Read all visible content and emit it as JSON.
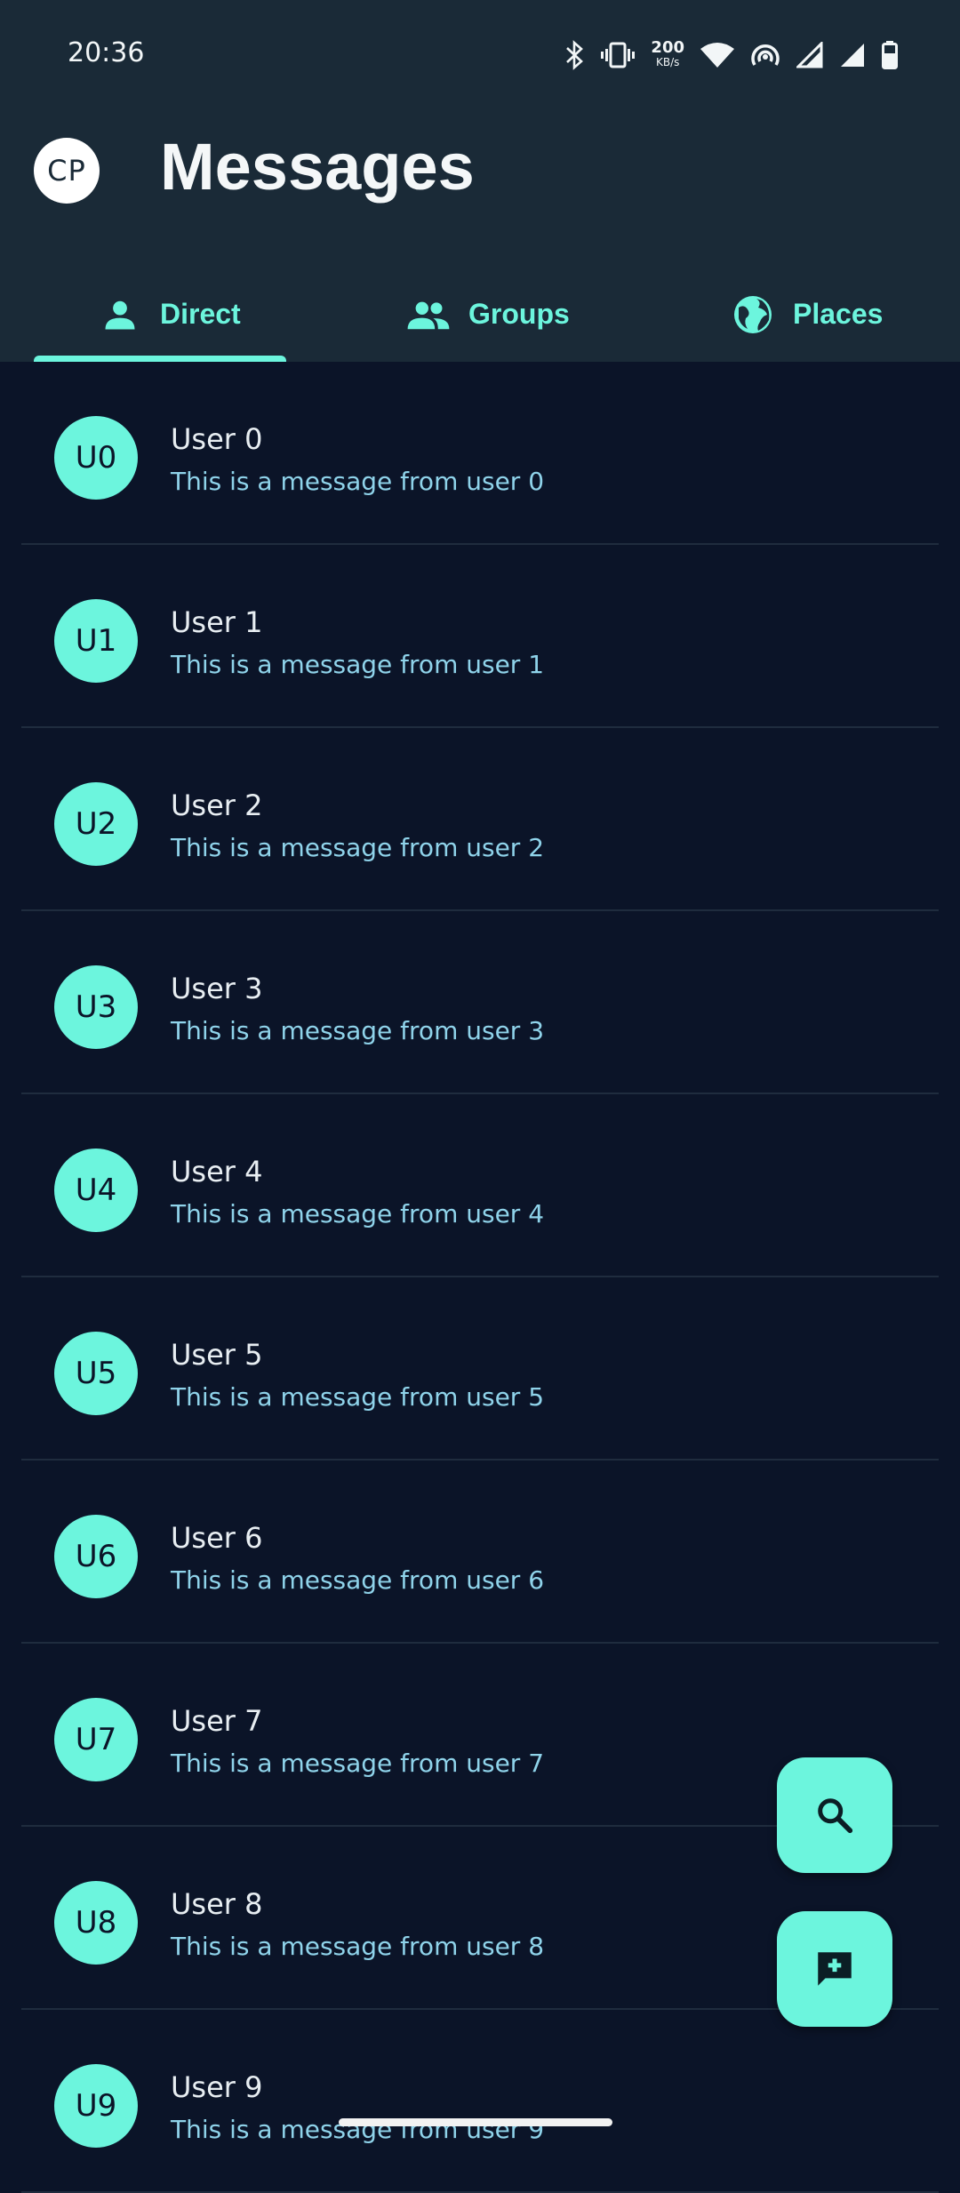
{
  "status_bar": {
    "time": "20:36",
    "speed_value": "200",
    "speed_unit": "KB/s",
    "icons": [
      "bluetooth-icon",
      "vibrate-icon",
      "wifi-icon",
      "hotspot-icon",
      "signal-icon",
      "signal-icon",
      "battery-icon"
    ]
  },
  "header": {
    "avatar_initials": "CP",
    "title": "Messages"
  },
  "tabs": [
    {
      "label": "Direct",
      "icon": "person-icon",
      "selected": true
    },
    {
      "label": "Groups",
      "icon": "group-icon",
      "selected": false
    },
    {
      "label": "Places",
      "icon": "globe-icon",
      "selected": false
    }
  ],
  "messages": [
    {
      "initials": "U0",
      "name": "User 0",
      "preview": "This is a message from user 0"
    },
    {
      "initials": "U1",
      "name": "User 1",
      "preview": "This is a message from user 1"
    },
    {
      "initials": "U2",
      "name": "User 2",
      "preview": "This is a message from user 2"
    },
    {
      "initials": "U3",
      "name": "User 3",
      "preview": "This is a message from user 3"
    },
    {
      "initials": "U4",
      "name": "User 4",
      "preview": "This is a message from user 4"
    },
    {
      "initials": "U5",
      "name": "User 5",
      "preview": "This is a message from user 5"
    },
    {
      "initials": "U6",
      "name": "User 6",
      "preview": "This is a message from user 6"
    },
    {
      "initials": "U7",
      "name": "User 7",
      "preview": "This is a message from user 7"
    },
    {
      "initials": "U8",
      "name": "User 8",
      "preview": "This is a message from user 8"
    },
    {
      "initials": "U9",
      "name": "User 9",
      "preview": "This is a message from user 9"
    }
  ],
  "fabs": {
    "search_icon": "search-icon",
    "compose_icon": "add-comment-icon"
  },
  "colors": {
    "header_bg": "#1a2a37",
    "list_bg": "#0b1428",
    "accent": "#6cf5dd",
    "preview_text": "#8fd3ea"
  }
}
